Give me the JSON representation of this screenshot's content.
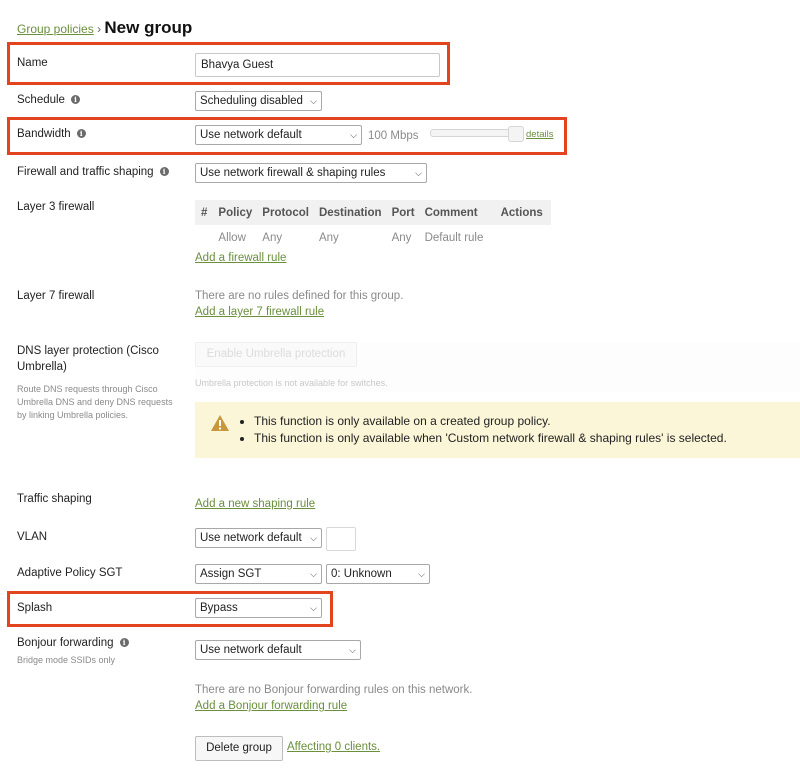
{
  "breadcrumb": {
    "parent": "Group policies",
    "sep": "›",
    "title": "New group"
  },
  "name": {
    "label": "Name",
    "value": "Bhavya Guest"
  },
  "schedule": {
    "label": "Schedule",
    "value": "Scheduling disabled"
  },
  "bandwidth": {
    "label": "Bandwidth",
    "value": "Use network default",
    "limit": "100 Mbps",
    "details": "details"
  },
  "firewall": {
    "label": "Firewall and traffic shaping",
    "value": "Use network firewall & shaping rules"
  },
  "l3": {
    "label": "Layer 3 firewall",
    "headers": [
      "#",
      "Policy",
      "Protocol",
      "Destination",
      "Port",
      "Comment",
      "Actions"
    ],
    "row": [
      "",
      "Allow",
      "Any",
      "Any",
      "Any",
      "Default rule",
      ""
    ],
    "add": "Add a firewall rule"
  },
  "l7": {
    "label": "Layer 7 firewall",
    "empty": "There are no rules defined for this group.",
    "add": "Add a layer 7 firewall rule"
  },
  "dns": {
    "label": "DNS layer protection (Cisco Umbrella)",
    "desc": "Route DNS requests through Cisco Umbrella DNS and deny DNS requests by linking Umbrella policies.",
    "button": "Enable Umbrella protection",
    "note": "Umbrella protection is not available for switches.",
    "warnings": [
      "This function is only available on a created group policy.",
      "This function is only available when 'Custom network firewall & shaping rules' is selected."
    ]
  },
  "traffic": {
    "label": "Traffic shaping",
    "add": "Add a new shaping rule"
  },
  "vlan": {
    "label": "VLAN",
    "value": "Use network default"
  },
  "sgt": {
    "label": "Adaptive Policy SGT",
    "value": "Assign SGT",
    "value2": "0: Unknown"
  },
  "splash": {
    "label": "Splash",
    "value": "Bypass"
  },
  "bonjour": {
    "label": "Bonjour forwarding",
    "sub": "Bridge mode SSIDs only",
    "value": "Use network default",
    "empty": "There are no Bonjour forwarding rules on this network.",
    "add": "Add a Bonjour forwarding rule"
  },
  "footer": {
    "delete": "Delete group",
    "affecting": "Affecting 0 clients."
  },
  "colors": {
    "highlight": "#e2451e",
    "link": "#6a8f3d",
    "warning_bg": "#fbf6d8",
    "warning_icon": "#c8963b"
  }
}
